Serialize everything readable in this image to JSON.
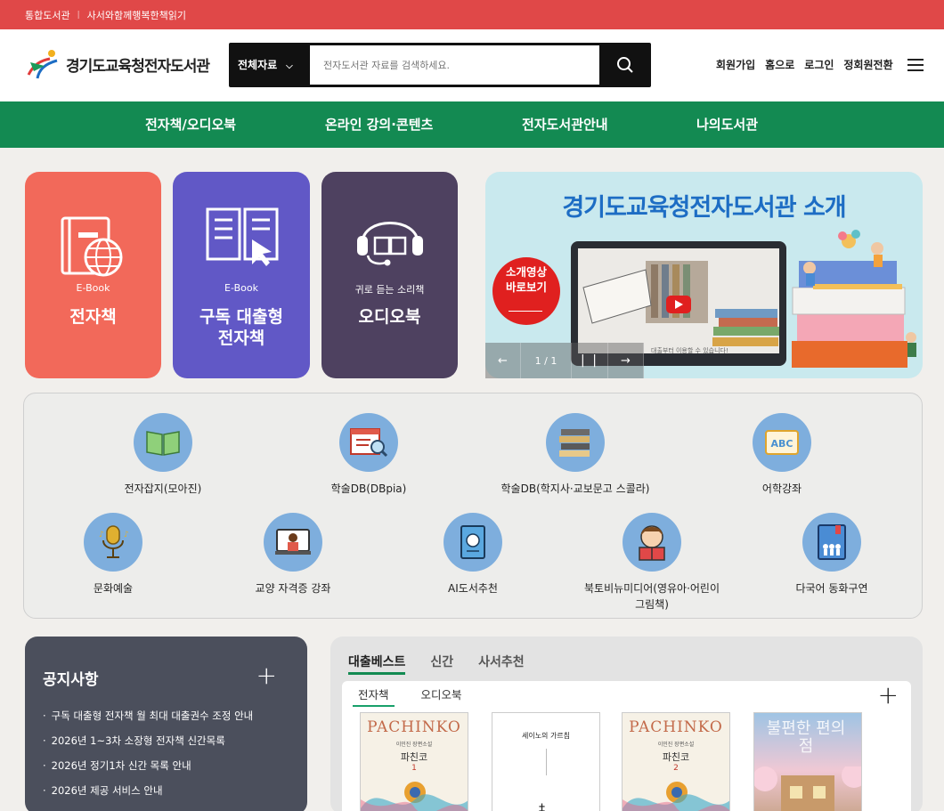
{
  "topbar": {
    "link1": "통합도서관",
    "sep": "|",
    "link2": "사서와함께행복한책읽기"
  },
  "header": {
    "logo_text": "경기도교육청전자도서관",
    "search": {
      "category": "전체자료",
      "placeholder": "전자도서관 자료를 검색하세요."
    },
    "util": [
      "회원가입",
      "홈으로",
      "로그인",
      "정회원전환"
    ]
  },
  "gnb": [
    "전자책/오디오북",
    "온라인 강의·콘텐츠",
    "전자도서관안내",
    "나의도서관"
  ],
  "cards": [
    {
      "en": "E-Book",
      "ko": "전자책",
      "color": "#f2695a"
    },
    {
      "en": "E-Book",
      "ko": "구독 대출형\n전자책",
      "color": "#6158c6"
    },
    {
      "en": "귀로 듣는 소리책",
      "ko": "오디오북",
      "color": "#4e4160"
    }
  ],
  "banner": {
    "title": "경기도교육청전자도서관 소개",
    "badge": "소개영상\n바로보기",
    "caption": "대출부터 이용할 수 있습니다!",
    "pager": "1 / 1"
  },
  "quick": [
    {
      "label": "전자잡지(모아진)",
      "icon": "open-book-icon"
    },
    {
      "label": "학술DB(DBpia)",
      "icon": "search-document-icon"
    },
    {
      "label": "학술DB(학지사·교보문고 스콜라)",
      "icon": "book-stack-icon"
    },
    {
      "label": "어학강좌",
      "icon": "abc-book-icon"
    },
    {
      "label": "문화예술",
      "icon": "microphone-icon"
    },
    {
      "label": "교양 자격증 강좌",
      "icon": "online-lecture-icon"
    },
    {
      "label": "AI도서추천",
      "icon": "ai-book-icon"
    },
    {
      "label": "북토비뉴미디어(영유아·어린이\n그림책)",
      "icon": "child-reading-icon"
    },
    {
      "label": "다국어 동화구연",
      "icon": "multilingual-book-icon"
    }
  ],
  "notice": {
    "title": "공지사항",
    "items": [
      "구독 대출형 전자책 월 최대 대출권수 조정 안내",
      "2026년 1~3차 소장형 전자책 신간목록",
      "2026년 정기1차 신간 목록 안내",
      "2026년 제공 서비스 안내"
    ]
  },
  "books": {
    "tabs": [
      "대출베스트",
      "신간",
      "사서추천"
    ],
    "subtabs": [
      "전자책",
      "오디오북"
    ],
    "items": [
      {
        "cover_title": "PACHINKO",
        "subtitle": "이민진 장편소설",
        "ko_title": "파친코",
        "vol": "1"
      },
      {
        "cover_title": "세이노의 가르침",
        "subtitle": "",
        "ko_title": "",
        "vol": ""
      },
      {
        "cover_title": "PACHINKO",
        "subtitle": "이민진 장편소설",
        "ko_title": "파친코",
        "vol": "2"
      },
      {
        "cover_title": "불편한 편의점",
        "subtitle": "",
        "ko_title": "",
        "vol": ""
      }
    ]
  }
}
